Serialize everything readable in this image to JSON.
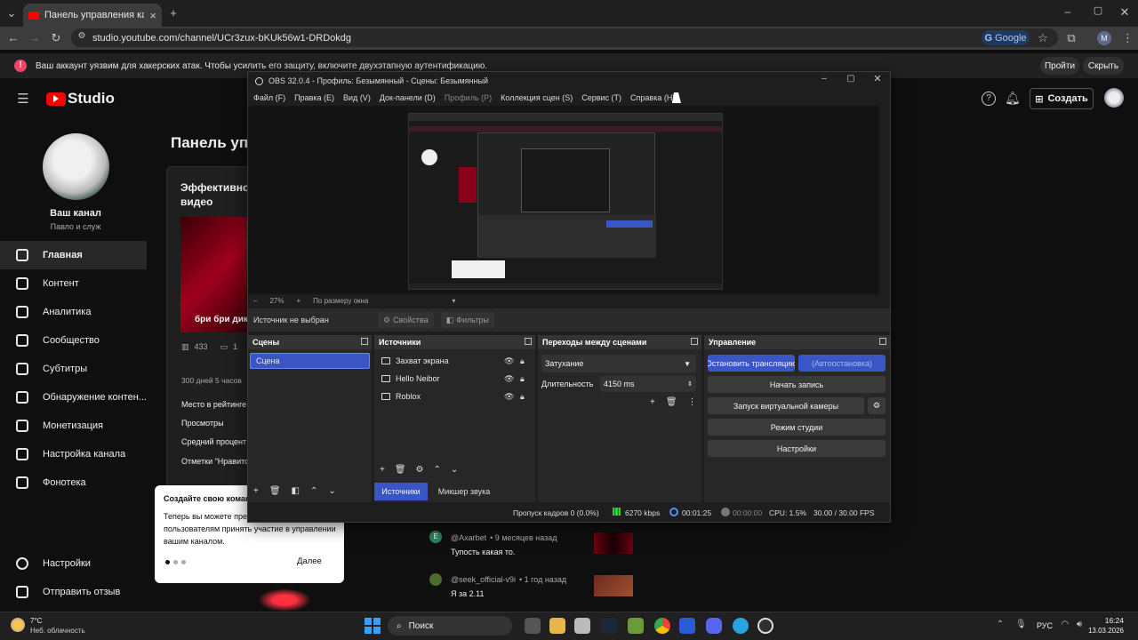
{
  "browser": {
    "tab_title": "Панель управления каналом",
    "url": "studio.youtube.com/channel/UCr3zux-bKUk56w1-DRDokdg",
    "google_label": "Google",
    "profile_initial": "M"
  },
  "banner": {
    "text": "Ваш аккаунт уязвим для хакерских атак. Чтобы усилить его защиту, включите двухэтапную аутентификацию.",
    "go_label": "Пройти",
    "hide_label": "Скрыть"
  },
  "studio": {
    "logo_text": "Studio",
    "create_label": "Создать",
    "channel_name": "Ваш канал",
    "channel_sub": "Павло и служ",
    "nav": [
      {
        "label": "Главная",
        "icon": "dashboard-icon",
        "active": true
      },
      {
        "label": "Контент",
        "icon": "content-icon"
      },
      {
        "label": "Аналитика",
        "icon": "analytics-icon"
      },
      {
        "label": "Сообщество",
        "icon": "community-icon"
      },
      {
        "label": "Субтитры",
        "icon": "subtitles-icon"
      },
      {
        "label": "Обнаружение контен...",
        "icon": "copyright-icon"
      },
      {
        "label": "Монетизация",
        "icon": "monetization-icon"
      },
      {
        "label": "Настройка канала",
        "icon": "customization-icon"
      },
      {
        "label": "Фонотека",
        "icon": "audio-library-icon"
      }
    ],
    "settings_label": "Настройки",
    "feedback_label": "Отправить отзыв",
    "dashboard_title": "Панель упра",
    "card_title": "Эффективно",
    "card_title2": "видео",
    "video_caption": "бри бри дику",
    "stat_views": "433",
    "stat_comments": "1",
    "since_text": "300 дней 5 часов",
    "metric1": "Место в рейтинге",
    "metric2": "Просмотры",
    "metric3": "Средний процент",
    "metric4": "Отметки \"Нравитс"
  },
  "popup": {
    "title": "Создайте свою команд",
    "body_line1": "Теперь вы можете пред",
    "body_line2": "пользователям принять участие в управлении",
    "body_line3": "вашим каналом.",
    "next_label": "Далее"
  },
  "comments": [
    {
      "author": "@Axarbet",
      "time": "• 9 месяцев назад",
      "text": "Тупость какая то.",
      "initial": "E"
    },
    {
      "author": "@seek_official-v9i",
      "time": "• 1 год назад",
      "text": "Я за 2.11"
    }
  ],
  "obs": {
    "title": "OBS 32.0.4 - Профиль: Безымянный - Сцены: Безымянный",
    "menu": [
      "Файл (F)",
      "Правка (E)",
      "Вид (V)",
      "Док-панели (D)",
      "Профиль (P)",
      "Коллекция сцен (S)",
      "Сервис (T)",
      "Справка (H)"
    ],
    "zoom": "27%",
    "fit_label": "По размеру окна",
    "no_source": "Источник не выбран",
    "props_label": "Свойства",
    "filters_label": "Фильтры",
    "scenes_header": "Сцены",
    "scenes": [
      "Сцена"
    ],
    "sources_header": "Источники",
    "sources": [
      {
        "name": "Захват экрана",
        "icon": "display-capture-icon"
      },
      {
        "name": "Hello Neibor",
        "icon": "window-capture-icon"
      },
      {
        "name": "Roblox",
        "icon": "window-capture-icon"
      }
    ],
    "tab_sources": "Источники",
    "tab_mixer": "Микшер звука",
    "transitions_header": "Переходы между сценами",
    "transition": "Затухание",
    "duration_label": "Длительность",
    "duration_value": "4150 ms",
    "controls_header": "Управление",
    "start_stream": "Остановить трансляцию",
    "auto_stop": "(Автоостановка)",
    "start_record": "Начать запись",
    "virtual_cam": "Запуск виртуальной камеры",
    "studio_mode": "Режим студии",
    "settings": "Настройки",
    "status": {
      "dropped": "Пропуск кадров 0 (0.0%)",
      "bitrate": "6270 kbps",
      "stream_time": "00:01:25",
      "rec_time": "00:00:00",
      "cpu": "CPU: 1.5%",
      "fps": "30.00 / 30.00 FPS"
    }
  },
  "taskbar": {
    "weather_temp": "7°C",
    "weather_desc": "Неб. облачность",
    "search_label": "Поиск",
    "lang": "РУС",
    "time": "16:24",
    "date": "13.03.2026"
  }
}
